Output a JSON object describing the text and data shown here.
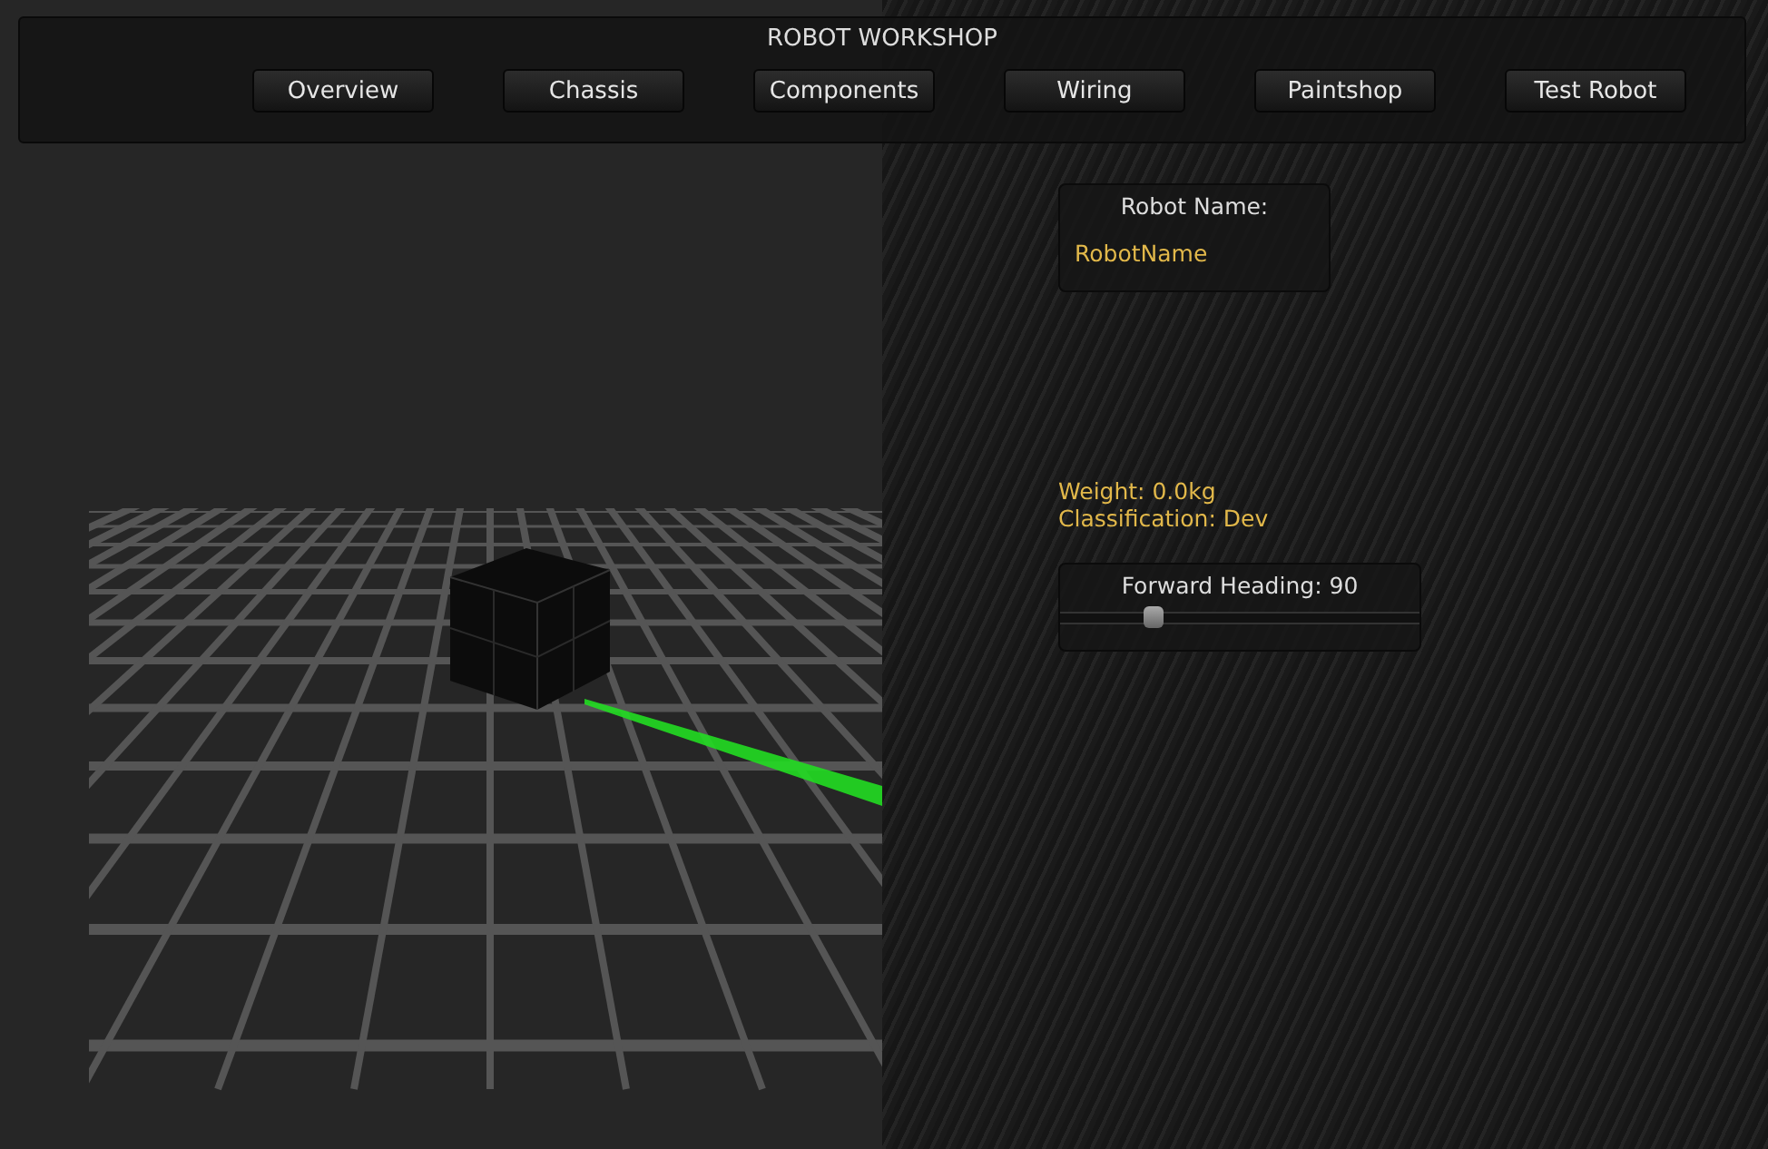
{
  "header": {
    "title": "ROBOT WORKSHOP",
    "tabs": [
      {
        "label": "Overview"
      },
      {
        "label": "Chassis"
      },
      {
        "label": "Components"
      },
      {
        "label": "Wiring"
      },
      {
        "label": "Paintshop"
      },
      {
        "label": "Test Robot"
      }
    ]
  },
  "name_panel": {
    "label": "Robot Name:",
    "value": "RobotName"
  },
  "stats": [
    "Weight: 0.0kg",
    "Classification: Dev"
  ],
  "heading_panel": {
    "label": "Forward Heading: 90",
    "level": 0.26
  }
}
